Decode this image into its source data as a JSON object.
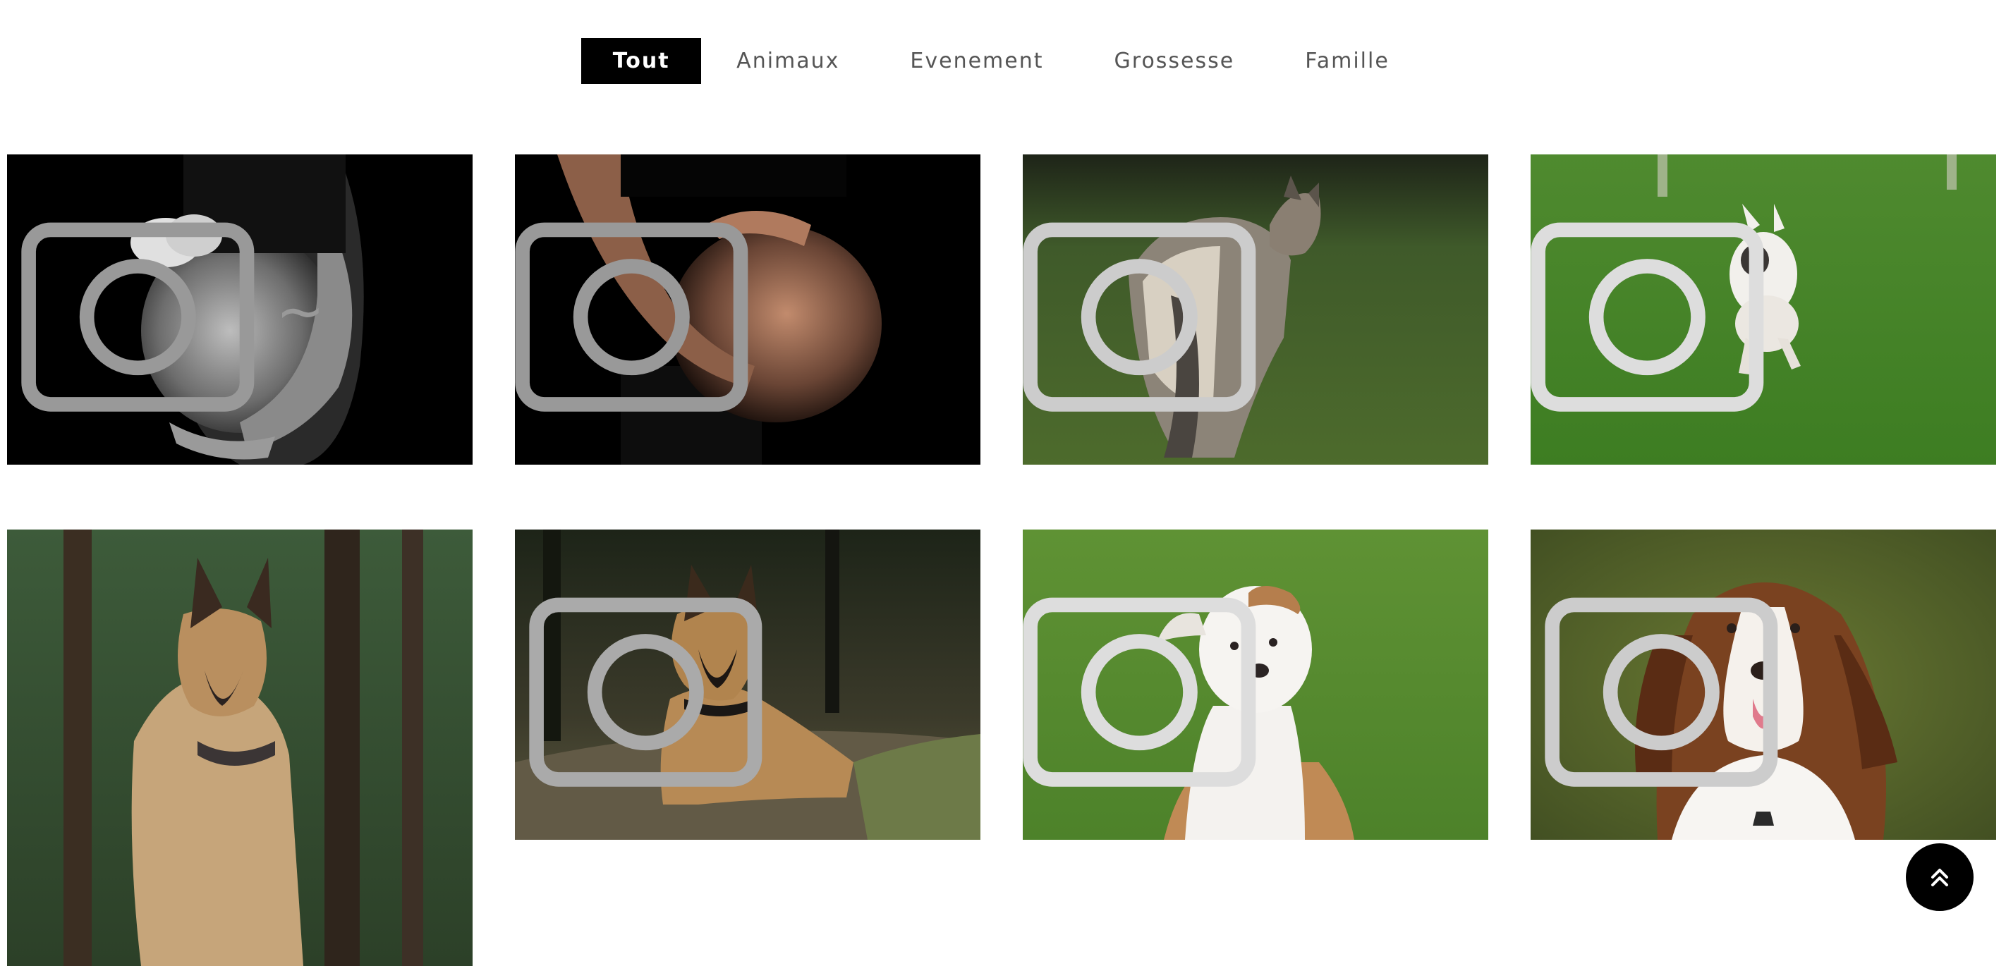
{
  "filters": {
    "items": [
      "Tout",
      "Animaux",
      "Evenement",
      "Grossesse",
      "Famille"
    ],
    "active": "Tout"
  },
  "gallery": {
    "photos": [
      {
        "category": "Grossesse",
        "subject": "pregnant belly holding baby shoes",
        "tone": "black-and-white"
      },
      {
        "category": "Grossesse",
        "subject": "pregnant belly low key",
        "tone": "color"
      },
      {
        "category": "Animaux",
        "subject": "wolfdog looking back in grass",
        "tone": "color"
      },
      {
        "category": "Animaux",
        "subject": "bull terrier running on grass",
        "tone": "color"
      },
      {
        "category": "Animaux",
        "subject": "german shepherd sitting in forest",
        "tone": "color"
      },
      {
        "category": "Animaux",
        "subject": "malinois lying on forest path",
        "tone": "color"
      },
      {
        "category": "Animaux",
        "subject": "white staffordshire on grass",
        "tone": "color"
      },
      {
        "category": "Animaux",
        "subject": "australian shepherd portrait",
        "tone": "color"
      }
    ]
  },
  "icons": {
    "to_top": "double-chevron-up-icon",
    "watermark": "camera-logo-icon"
  },
  "colors": {
    "active_bg": "#000000",
    "active_text": "#ffffff",
    "inactive_text": "#555555",
    "to_top_bg": "#000000"
  }
}
